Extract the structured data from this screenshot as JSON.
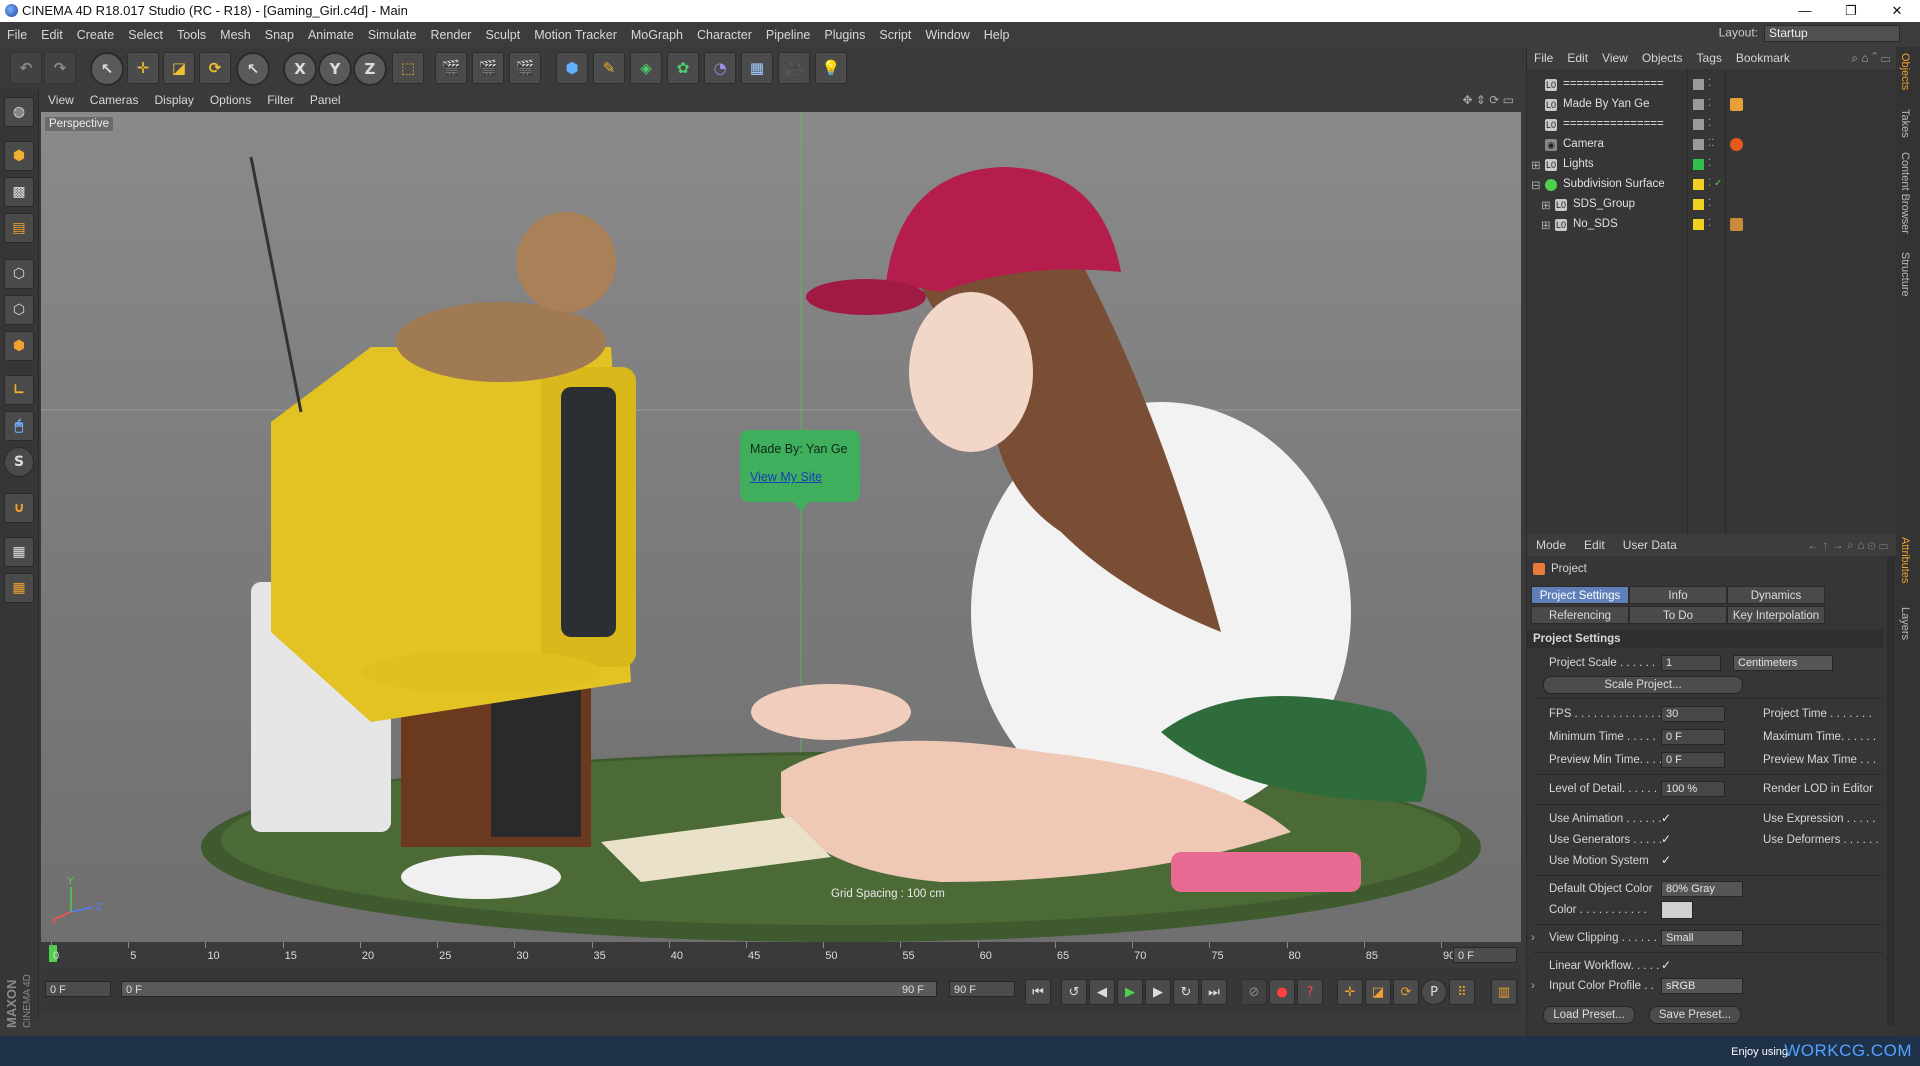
{
  "window": {
    "title": "CINEMA 4D R18.017 Studio (RC - R18) - [Gaming_Girl.c4d] - Main",
    "controls": [
      "—",
      "❐",
      "✕"
    ]
  },
  "menubar": [
    "File",
    "Edit",
    "Create",
    "Select",
    "Tools",
    "Mesh",
    "Snap",
    "Animate",
    "Simulate",
    "Render",
    "Sculpt",
    "Motion Tracker",
    "MoGraph",
    "Character",
    "Pipeline",
    "Plugins",
    "Script",
    "Window",
    "Help"
  ],
  "layout": {
    "label": "Layout:",
    "value": "Startup"
  },
  "toolbar": {
    "x": "X",
    "y": "Y",
    "z": "Z"
  },
  "leftbar": {
    "s_label": "S"
  },
  "viewport": {
    "menu": [
      "View",
      "Cameras",
      "Display",
      "Options",
      "Filter",
      "Panel"
    ],
    "camera_label": "Perspective",
    "grid_spacing": "Grid Spacing : 100 cm",
    "bubble": {
      "line1": "Made By: Yan Ge",
      "link": "View My Site"
    },
    "axes": {
      "y": "Y",
      "z": "Z",
      "x": "X"
    }
  },
  "timeline": {
    "ticks": [
      "0",
      "5",
      "10",
      "15",
      "20",
      "25",
      "30",
      "35",
      "40",
      "45",
      "50",
      "55",
      "60",
      "65",
      "70",
      "75",
      "80",
      "85",
      "90"
    ],
    "current_frame": "0 F",
    "start_field": "0 F",
    "slider_start": "0 F",
    "slider_end": "90 F",
    "end_field": "90 F"
  },
  "objects": {
    "menu": [
      "File",
      "Edit",
      "View",
      "Objects",
      "Tags",
      "Bookmark"
    ],
    "items": [
      {
        "name": "===============",
        "swatch": "#9a9a9a"
      },
      {
        "name": "Made By Yan Ge",
        "swatch": "#9a9a9a",
        "tag": "#e8a03a"
      },
      {
        "name": "===============",
        "swatch": "#9a9a9a"
      },
      {
        "name": "Camera",
        "swatch": "#9a9a9a",
        "tag": "#e85a1a"
      },
      {
        "name": "Lights",
        "swatch": "#2ec04a"
      },
      {
        "name": "Subdivision Surface",
        "swatch": "#f0d020"
      },
      {
        "name": "SDS_Group",
        "swatch": "#f0d020"
      },
      {
        "name": "No_SDS",
        "swatch": "#f0d020",
        "tag": "#c98a3a"
      }
    ]
  },
  "attributes": {
    "menu": [
      "Mode",
      "Edit",
      "User Data"
    ],
    "header": "Project",
    "tabs": [
      "Project Settings",
      "Info",
      "Dynamics",
      "Referencing",
      "To Do",
      "Key Interpolation"
    ],
    "section": "Project Settings",
    "project_scale": {
      "label": "Project Scale . . . . . .",
      "value": "1",
      "unit": "Centimeters"
    },
    "scale_project_button": "Scale Project...",
    "fps": {
      "label": "FPS . . . . . . . . . . . . . .",
      "value": "30"
    },
    "project_time": "Project Time . . . . . . .",
    "minimum_time": {
      "label": "Minimum Time . . . . .",
      "value": "0 F"
    },
    "maximum_time": "Maximum Time. . . . . .",
    "preview_min": {
      "label": "Preview Min Time. . . .",
      "value": "0 F"
    },
    "preview_max": "Preview Max Time . . .",
    "lod": {
      "label": "Level of Detail. . . . . .",
      "value": "100 %"
    },
    "render_lod": "Render LOD in Editor",
    "use_animation": "Use Animation . . . . . .",
    "use_expression": "Use Expression . . . . .",
    "use_generators": "Use Generators . . . . .",
    "use_deformers": "Use Deformers . . . . . .",
    "use_motion": "Use Motion System",
    "default_color": {
      "label": "Default Object Color",
      "value": "80% Gray"
    },
    "color": {
      "label": "Color . . . . . . . . . . .",
      "swatch": "#d0d0d0"
    },
    "view_clipping": {
      "label": "View Clipping . . . . . .",
      "value": "Small"
    },
    "linear_workflow": "Linear Workflow. . . . .",
    "input_color_profile": {
      "label": "Input Color Profile . .",
      "value": "sRGB"
    },
    "load_preset": "Load Preset...",
    "save_preset": "Save Preset...",
    "check": "✓"
  },
  "right_tabs": [
    "Objects",
    "Takes",
    "Content Browser",
    "Structure",
    "Attributes",
    "Layers"
  ],
  "status": {
    "enjoy": "Enjoy using",
    "brand": "WORKCG.COM"
  },
  "maxon": {
    "l1": "MAXON",
    "l2": "CINEMA 4D"
  }
}
